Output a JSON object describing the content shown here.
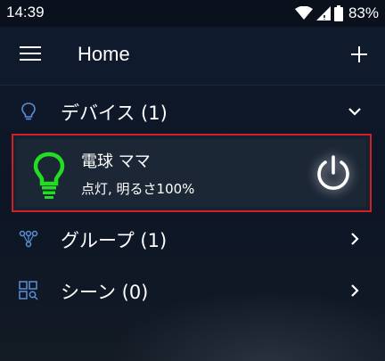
{
  "status_bar": {
    "time": "14:39",
    "battery_percent": "83%",
    "icons": [
      "wifi-icon",
      "cell-signal-icon",
      "battery-icon"
    ]
  },
  "app_bar": {
    "title": "Home",
    "menu_icon": "hamburger-menu-icon",
    "add_icon": "plus-icon"
  },
  "sections": {
    "devices": {
      "label": "デバイス (1)",
      "icon": "bulb-outline-icon",
      "expanded": true,
      "items": [
        {
          "name": "電球 ママ",
          "status": "点灯, 明るさ100%",
          "icon": "bulb-icon",
          "icon_color": "#22dd22",
          "power_icon": "power-icon",
          "brightness": 1.0
        }
      ]
    },
    "groups": {
      "label": "グループ (1)",
      "icon": "group-nodes-icon",
      "expanded": false
    },
    "scenes": {
      "label": "シーン (0)",
      "icon": "scene-grid-icon",
      "expanded": false
    }
  },
  "colors": {
    "background": "#0f1a2b",
    "highlight_border": "#d21f26",
    "bulb_on": "#22dd22",
    "icon_accent": "#5b8fd6"
  }
}
